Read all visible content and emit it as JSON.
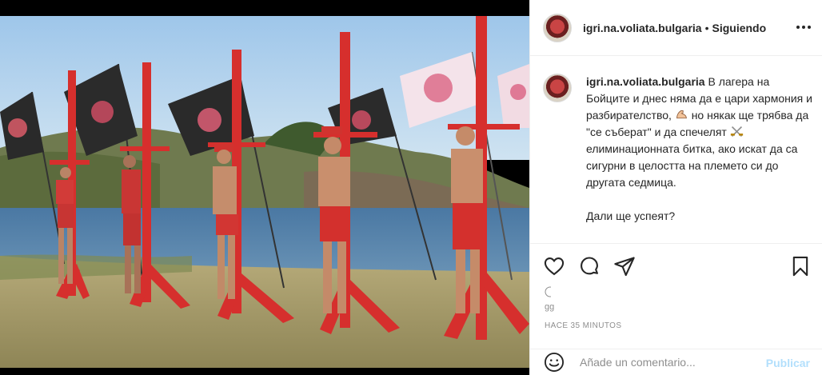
{
  "header": {
    "username": "igri.na.voliata.bulgaria",
    "separator": "•",
    "follow_state": "Siguiendo",
    "more_icon": "more-horizontal-icon"
  },
  "caption": {
    "username": "igri.na.voliata.bulgaria",
    "text_1": "В лагера на Бойците и днес няма да е цари хармония и разбирателство,",
    "text_2": "но някак ще трябва да \"се съберат\" и да спечелят",
    "text_3": "елиминационната битка, ако искат да са сигурни в целостта на племето си до другата седмица.",
    "question": "Дали ще успеят?",
    "emoji_1": "flexed-biceps-icon",
    "emoji_2": "crossed-swords-icon"
  },
  "actions": {
    "like_icon": "heart-icon",
    "comment_icon": "comment-icon",
    "share_icon": "send-icon",
    "save_icon": "bookmark-icon"
  },
  "likes": {
    "text": "gg"
  },
  "post": {
    "time_ago": "HACE 35 MINUTOS"
  },
  "comment_box": {
    "placeholder": "Añade un comentario...",
    "publish_label": "Publicar",
    "emoji_icon": "smiley-icon"
  },
  "colors": {
    "text": "#262626",
    "muted": "#8e8e8e",
    "publish_disabled": "#b2dffc",
    "post_red": "#d8302c"
  }
}
